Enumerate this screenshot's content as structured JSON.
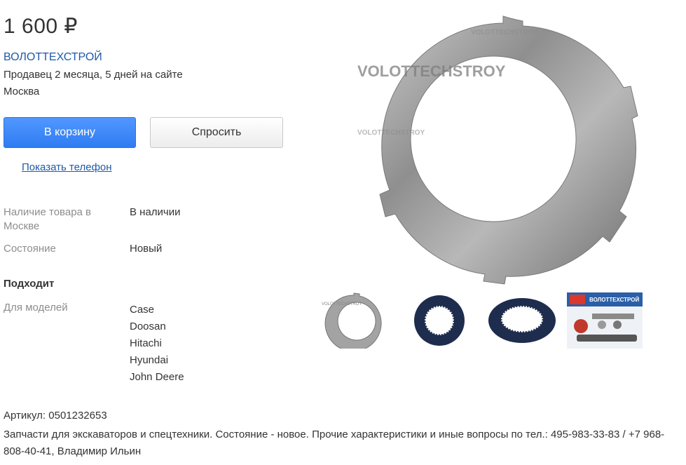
{
  "listing": {
    "price": "1 600 ₽",
    "seller_name": "ВОЛОТТЕХСТРОЙ",
    "seller_since": "Продавец 2 месяца, 5 дней на сайте",
    "seller_city": "Москва"
  },
  "actions": {
    "cart_label": "В корзину",
    "ask_label": "Спросить",
    "show_phone_label": "Показать телефон"
  },
  "specs": [
    {
      "label": "Наличие товара в Москве",
      "value": "В наличии"
    },
    {
      "label": "Состояние",
      "value": "Новый"
    }
  ],
  "fits": {
    "title": "Подходит",
    "models_label": "Для моделей",
    "models": [
      "Case",
      "Doosan",
      "Hitachi",
      "Hyundai",
      "John Deere"
    ]
  },
  "article": "Артикул: 0501232653",
  "description": "Запчасти для экскаваторов и спецтехники. Состояние - новое. Прочие характеристики и иные вопросы по тел.: 495-983-33-83 / +7 968-808-40-41, Владимир Ильин",
  "gallery": {
    "watermark": "VOLOTTECHSTROY",
    "thumbs": [
      {
        "name": "steel-disc-thumb"
      },
      {
        "name": "friction-disc-thumb"
      },
      {
        "name": "friction-disc-angle-thumb"
      },
      {
        "name": "company-ad-thumb",
        "title": "ВОЛОТТЕХСТРОЙ"
      }
    ]
  }
}
